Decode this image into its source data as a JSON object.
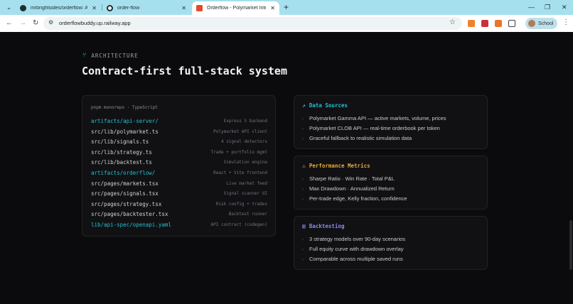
{
  "browser": {
    "tabs": [
      {
        "title": "mrbrightsides/orderflow: A live"
      },
      {
        "title": "order-flow"
      },
      {
        "title": "Orderflow - Polymarket Intellige"
      }
    ],
    "url": "orderflowbuddy.up.railway.app",
    "profile_label": "School",
    "colors": {
      "tabbar": "#a6e0ee",
      "active_tab": "#ffffff"
    }
  },
  "section": {
    "eyebrow": "ARCHITECTURE",
    "title": "Contract-first full-stack system"
  },
  "code_panel": {
    "header": "pnpm monorepo · TypeScript",
    "rows": [
      {
        "path": "artifacts/api-server/",
        "desc": "Express 5 backend",
        "highlight": true
      },
      {
        "path": "src/lib/polymarket.ts",
        "desc": "Polymarket API client",
        "highlight": false
      },
      {
        "path": "src/lib/signals.ts",
        "desc": "4 signal detectors",
        "highlight": false
      },
      {
        "path": "src/lib/strategy.ts",
        "desc": "Trade + portfolio mgmt",
        "highlight": false
      },
      {
        "path": "src/lib/backtest.ts",
        "desc": "Simulation engine",
        "highlight": false
      },
      {
        "path": "artifacts/orderflow/",
        "desc": "React + Vite frontend",
        "highlight": true
      },
      {
        "path": "src/pages/markets.tsx",
        "desc": "Live market feed",
        "highlight": false
      },
      {
        "path": "src/pages/signals.tsx",
        "desc": "Signal scanner UI",
        "highlight": false
      },
      {
        "path": "src/pages/strategy.tsx",
        "desc": "Risk config + trades",
        "highlight": false
      },
      {
        "path": "src/pages/backtester.tsx",
        "desc": "Backtest runner",
        "highlight": false
      },
      {
        "path": "lib/api-spec/openapi.yaml",
        "desc": "API contract (codegen)",
        "highlight": true
      }
    ]
  },
  "cards": [
    {
      "title": "Data Sources",
      "icon": "trend-up-icon",
      "color": "#22c1d4",
      "items": [
        "Polymarket Gamma API — active markets, volume, prices",
        "Polymarket CLOB API — real-time orderbook per token",
        "Graceful fallback to realistic simulation data"
      ]
    },
    {
      "title": "Performance Metrics",
      "icon": "warning-icon",
      "color": "#e8a93a",
      "items": [
        "Sharpe Ratio · Win Rate · Total P&L",
        "Max Drawdown · Annualized Return",
        "Per-trade edge, Kelly fraction, confidence"
      ]
    },
    {
      "title": "Backtesting",
      "icon": "bar-chart-icon",
      "color": "#8d8cf0",
      "items": [
        "3 strategy models over 90-day scenarios",
        "Full equity curve with drawdown overlay",
        "Comparable across multiple saved runs"
      ]
    }
  ]
}
